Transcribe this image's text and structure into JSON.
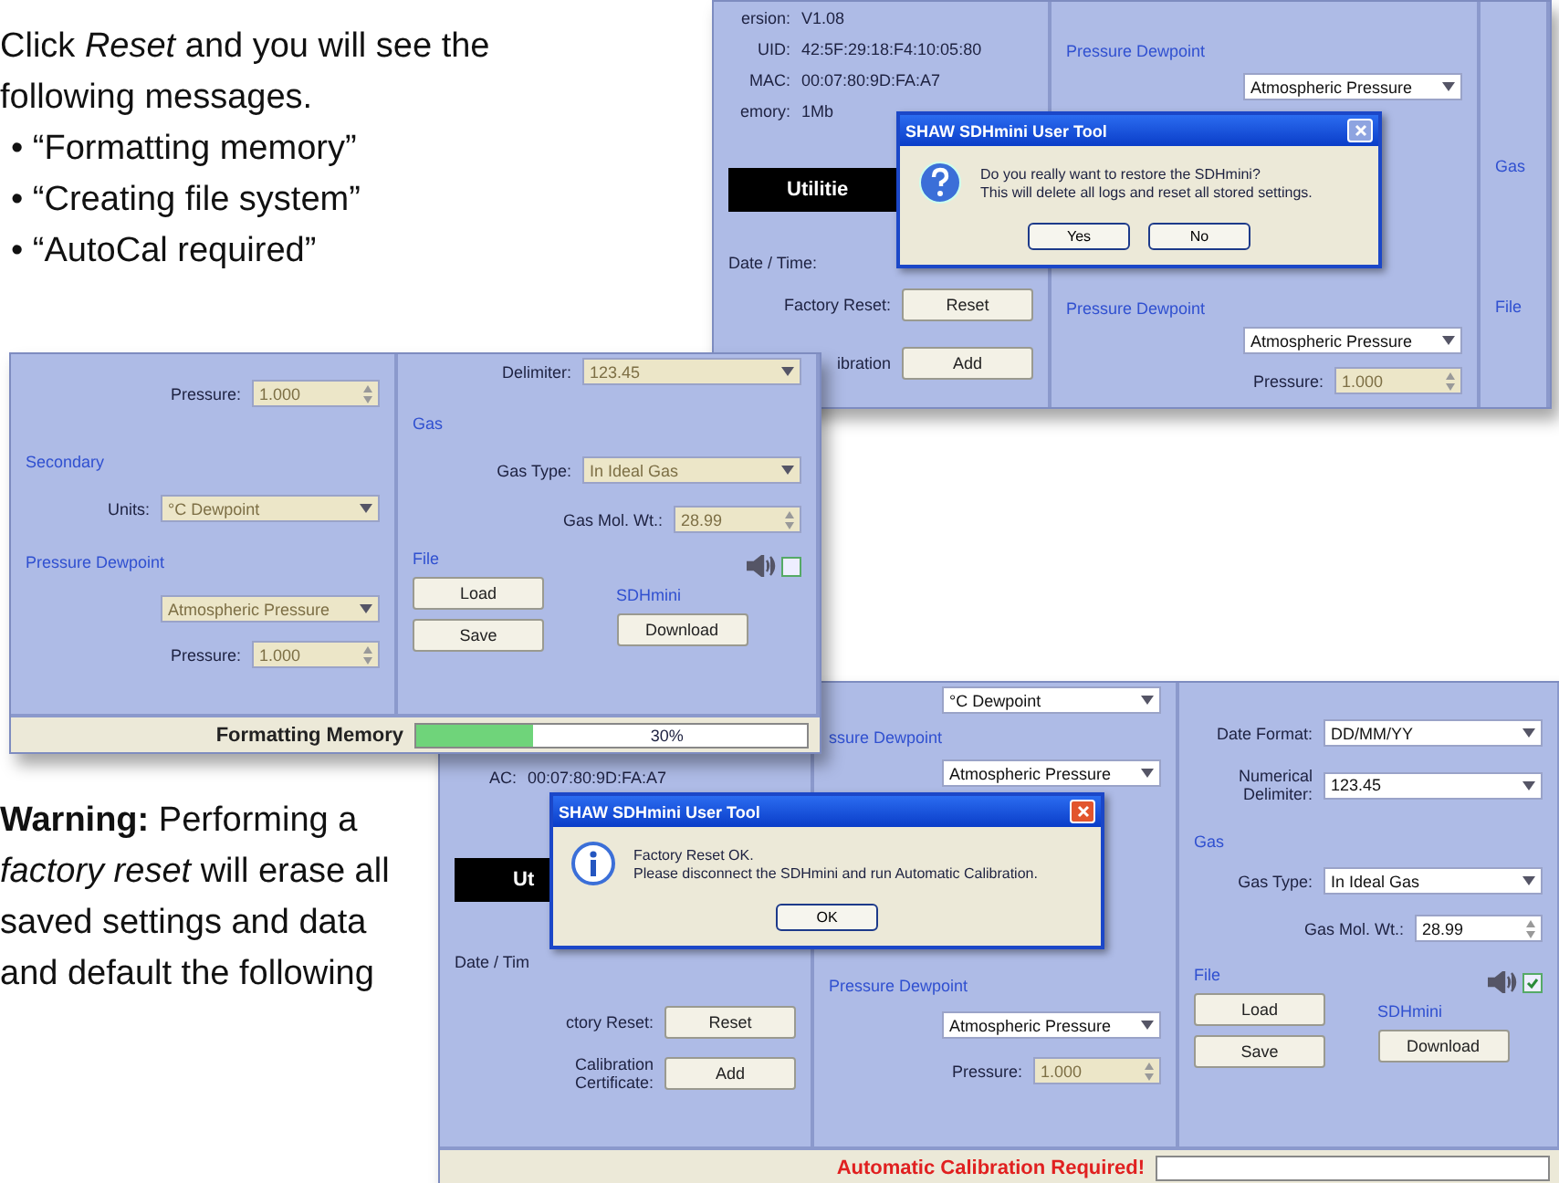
{
  "intro": {
    "text": "Click *Reset* and you will see the following messages.",
    "bullets": [
      "• “Formatting memory”",
      "• “Creating file system”",
      "• “AutoCal required”"
    ]
  },
  "warning": {
    "text": "**Warning:** Performing a *factory reset* will erase all saved settings and data and default the following"
  },
  "screenshots": [
    {
      "columns": [
        [
          {
            "kind": "info",
            "label": "ersion:",
            "value": "V1.08"
          },
          {
            "kind": "info",
            "label": "UID:",
            "value": "42:5F:29:18:F4:10:05:80"
          },
          {
            "kind": "info",
            "label": "MAC:",
            "value": "00:07:80:9D:FA:A7"
          },
          {
            "kind": "info",
            "label": "emory:",
            "value": "1Mb"
          },
          {
            "kind": "heading",
            "text": "Utilitie"
          },
          {
            "kind": "label",
            "label": "Date / Time:"
          },
          {
            "kind": "button",
            "label": "Factory Reset:",
            "button": "Reset"
          },
          {
            "kind": "button",
            "label": "ibration",
            "button": "Add"
          }
        ],
        [
          {
            "kind": "group",
            "title": "Pressure Dewpoint"
          },
          {
            "kind": "dropdown",
            "value": "Atmospheric Pressure",
            "disabled": false
          },
          {
            "kind": "group",
            "title": "Pressure Dewpoint"
          },
          {
            "kind": "dropdown",
            "value": "Atmospheric Pressure",
            "disabled": false
          },
          {
            "kind": "spinner",
            "label": "Pressure:",
            "value": "1.000",
            "disabled": true
          }
        ],
        [
          {
            "kind": "group",
            "title": "Gas"
          },
          {
            "kind": "group",
            "title": "File"
          }
        ]
      ],
      "dialog": {
        "title": "SHAW SDHmini User Tool",
        "kind": "question",
        "close_enabled": false,
        "lines": [
          "Do you really want to restore the SDHmini?",
          "This will delete all logs and reset all stored settings."
        ],
        "buttons": [
          "Yes",
          "No"
        ]
      }
    },
    {
      "columns": [
        [
          {
            "kind": "spinner",
            "label": "Pressure:",
            "value": "1.000",
            "disabled": true
          },
          {
            "kind": "group",
            "title": "Secondary"
          },
          {
            "kind": "dropdown",
            "label": "Units:",
            "value": "°C Dewpoint",
            "disabled": true
          },
          {
            "kind": "group",
            "title": "Pressure Dewpoint"
          },
          {
            "kind": "dropdown",
            "value": "Atmospheric Pressure",
            "disabled": true
          },
          {
            "kind": "spinner",
            "label": "Pressure:",
            "value": "1.000",
            "disabled": true
          }
        ],
        [
          {
            "kind": "dropdown",
            "label": "Delimiter:",
            "value": "123.45",
            "disabled": true
          },
          {
            "kind": "group",
            "title": "Gas"
          },
          {
            "kind": "dropdown",
            "label": "Gas Type:",
            "value": "In Ideal Gas",
            "disabled": true
          },
          {
            "kind": "spinner",
            "label": "Gas Mol. Wt.:",
            "value": "28.99",
            "disabled": true
          },
          {
            "kind": "file",
            "title": "File",
            "buttons": [
              "Load",
              "Save"
            ],
            "device_title": "SDHmini",
            "device_button": "Download",
            "sound_checked": false
          }
        ]
      ],
      "status": {
        "text": "Formatting Memory",
        "alert": false,
        "level": 0.3,
        "reading": "30%"
      }
    },
    {
      "columns": [
        [
          {
            "kind": "info",
            "label": "AC:",
            "value": "00:07:80:9D:FA:A7"
          },
          {
            "kind": "heading",
            "text": "Ut"
          },
          {
            "kind": "label",
            "label": "Date / Tim"
          },
          {
            "kind": "button",
            "label": "ctory Reset:",
            "button": "Reset"
          },
          {
            "kind": "button",
            "label": "Calibration Certificate:",
            "button": "Add"
          }
        ],
        [
          {
            "kind": "dropdown",
            "value": "°C Dewpoint",
            "disabled": false
          },
          {
            "kind": "group",
            "title": "ssure Dewpoint"
          },
          {
            "kind": "dropdown",
            "value": "Atmospheric Pressure",
            "disabled": false
          },
          {
            "kind": "group",
            "title": "Pressure Dewpoint"
          },
          {
            "kind": "dropdown",
            "value": "Atmospheric Pressure",
            "disabled": false
          },
          {
            "kind": "spinner",
            "label": "Pressure:",
            "value": "1.000",
            "disabled": true
          }
        ],
        [
          {
            "kind": "dropdown",
            "label": "Date Format:",
            "value": "DD/MM/YY",
            "disabled": false
          },
          {
            "kind": "dropdown",
            "label": "Numerical Delimiter:",
            "value": "123.45",
            "disabled": false
          },
          {
            "kind": "group",
            "title": "Gas"
          },
          {
            "kind": "dropdown",
            "label": "Gas Type:",
            "value": "In Ideal Gas",
            "disabled": false
          },
          {
            "kind": "spinner",
            "label": "Gas Mol. Wt.:",
            "value": "28.99",
            "disabled": false
          },
          {
            "kind": "file",
            "title": "File",
            "buttons": [
              "Load",
              "Save"
            ],
            "device_title": "SDHmini",
            "device_button": "Download",
            "sound_checked": true
          }
        ]
      ],
      "dialog": {
        "title": "SHAW SDHmini User Tool",
        "kind": "info",
        "close_enabled": true,
        "lines": [
          "Factory Reset OK.",
          "Please disconnect the SDHmini and run Automatic Calibration."
        ],
        "buttons": [
          "OK"
        ]
      },
      "status": {
        "text": "Automatic Calibration Required!",
        "alert": true
      }
    }
  ]
}
